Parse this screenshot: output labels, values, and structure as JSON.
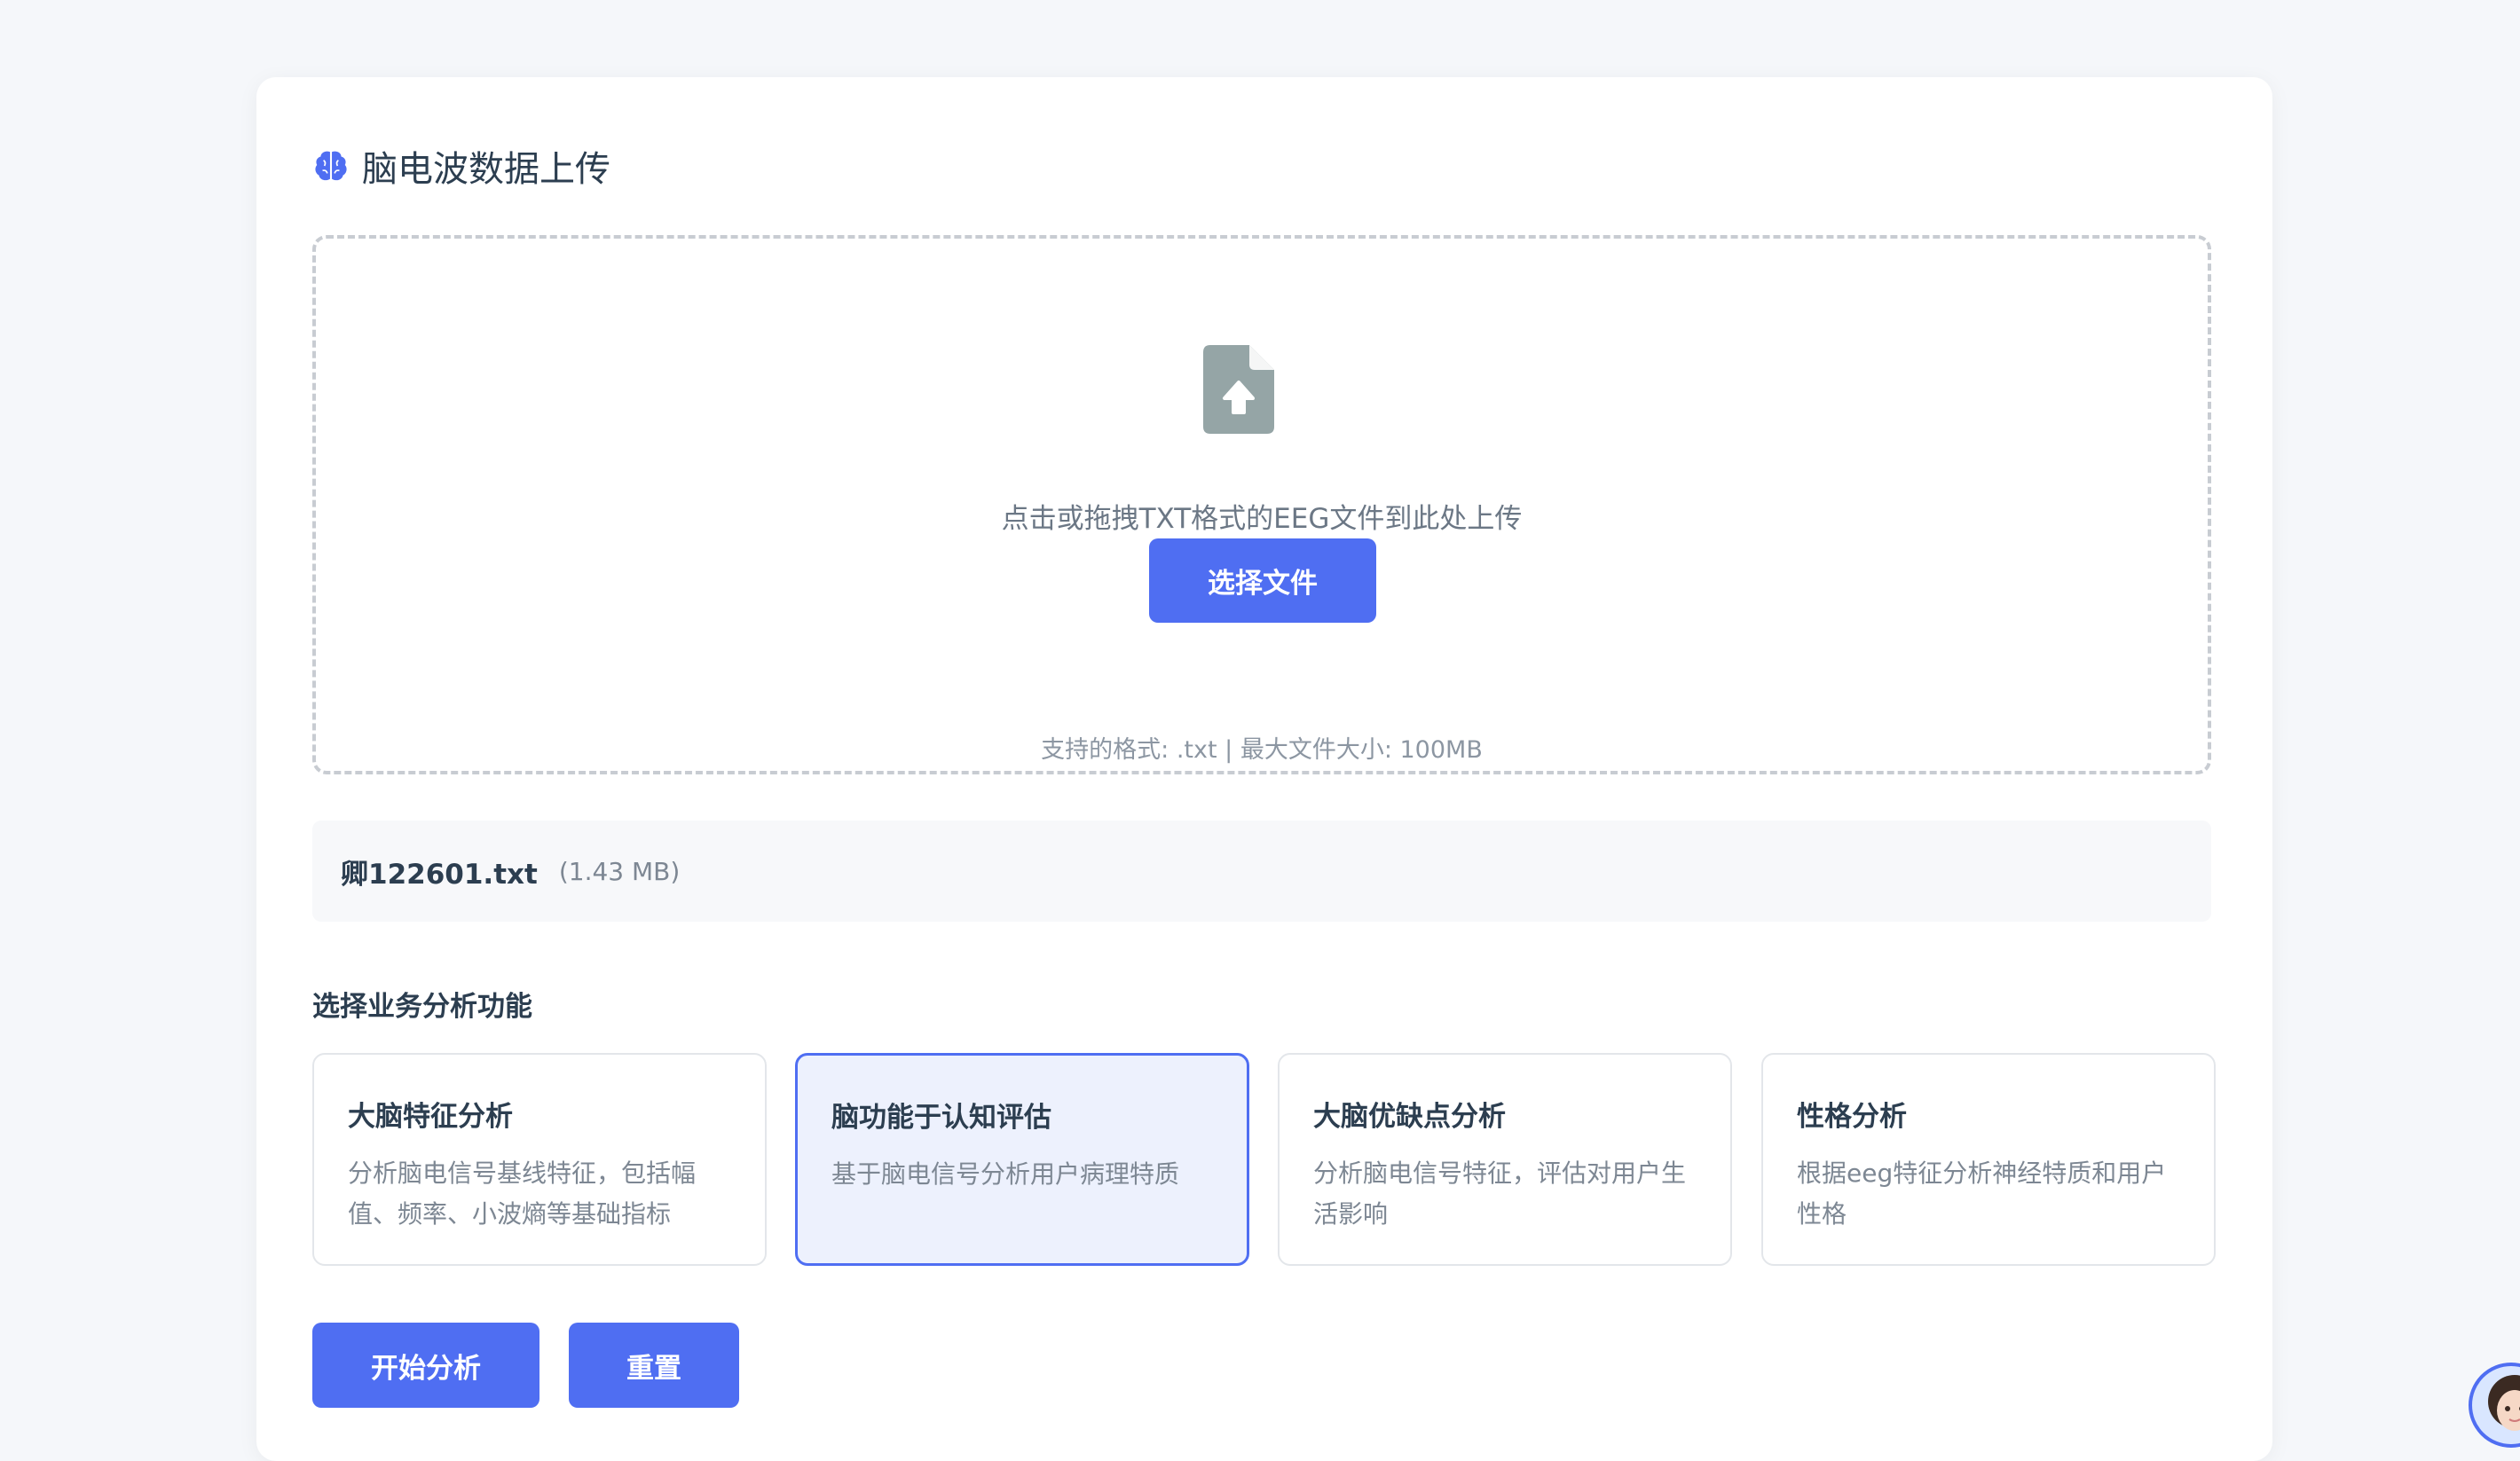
{
  "header": {
    "title": "脑电波数据上传",
    "icon": "brain-icon"
  },
  "upload": {
    "icon": "file-upload-icon",
    "prompt": "点击或拖拽TXT格式的EEG文件到此处上传",
    "button_label": "选择文件",
    "hint": "支持的格式: .txt | 最大文件大小: 100MB"
  },
  "file": {
    "name": "卿122601.txt",
    "size": "(1.43 MB)"
  },
  "functions": {
    "label": "选择业务分析功能",
    "items": [
      {
        "title": "大脑特征分析",
        "desc": "分析脑电信号基线特征，包括幅值、频率、小波熵等基础指标",
        "selected": false
      },
      {
        "title": "脑功能于认知评估",
        "desc": "基于脑电信号分析用户病理特质",
        "selected": true
      },
      {
        "title": "大脑优缺点分析",
        "desc": "分析脑电信号特征，评估对用户生活影响",
        "selected": false
      },
      {
        "title": "性格分析",
        "desc": "根据eeg特征分析神经特质和用户性格",
        "selected": false
      }
    ]
  },
  "actions": {
    "start_label": "开始分析",
    "reset_label": "重置"
  },
  "colors": {
    "accent": "#4f6ef2",
    "selected_bg": "#edf1fd",
    "page_bg": "#f5f7fa"
  }
}
